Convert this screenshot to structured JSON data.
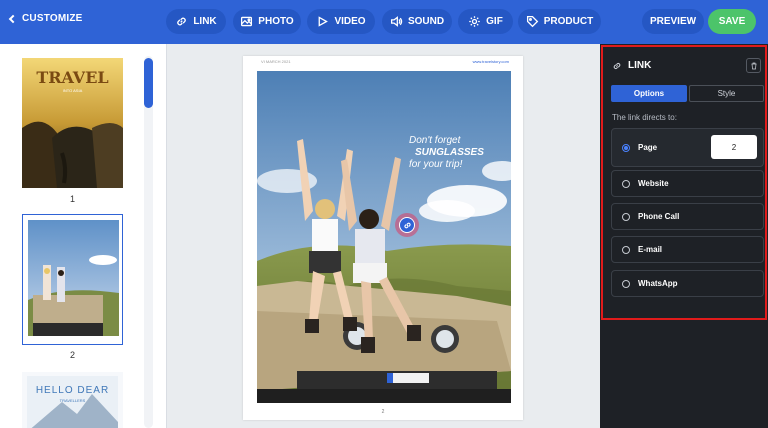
{
  "topbar": {
    "back_label": "CUSTOMIZE",
    "tools": [
      {
        "label": "LINK",
        "icon": "link-icon"
      },
      {
        "label": "PHOTO",
        "icon": "photo-icon"
      },
      {
        "label": "VIDEO",
        "icon": "video-icon"
      },
      {
        "label": "SOUND",
        "icon": "sound-icon"
      },
      {
        "label": "GIF",
        "icon": "gif-icon"
      },
      {
        "label": "PRODUCT",
        "icon": "tag-icon"
      }
    ],
    "preview_label": "PREVIEW",
    "save_label": "SAVE"
  },
  "thumbnails": [
    {
      "number": "1",
      "title": "TRAVEL",
      "subtitle": "INTO ASIA",
      "selected": false
    },
    {
      "number": "2",
      "selected": true
    },
    {
      "title": "HELLO DEAR",
      "subtitle": "TRAVELLERS"
    }
  ],
  "page": {
    "header_left": "VI MARCH 2021",
    "header_right": "www.travelstory.com",
    "text_line1": "Don't forget",
    "text_line2": "SUNGLASSES",
    "text_line3": "for your trip!",
    "page_number": "2"
  },
  "link_panel": {
    "title": "LINK",
    "tab_options": "Options",
    "tab_style": "Style",
    "directs_label": "The link directs to:",
    "options": [
      {
        "label": "Page",
        "selected": true,
        "value": "2"
      },
      {
        "label": "Website",
        "selected": false
      },
      {
        "label": "Phone Call",
        "selected": false
      },
      {
        "label": "E-mail",
        "selected": false
      },
      {
        "label": "WhatsApp",
        "selected": false
      }
    ]
  },
  "colors": {
    "topbar": "#2f63d6",
    "save": "#4cc46a",
    "panel_bg": "#1e2126",
    "highlight_frame": "#e01b1b"
  }
}
